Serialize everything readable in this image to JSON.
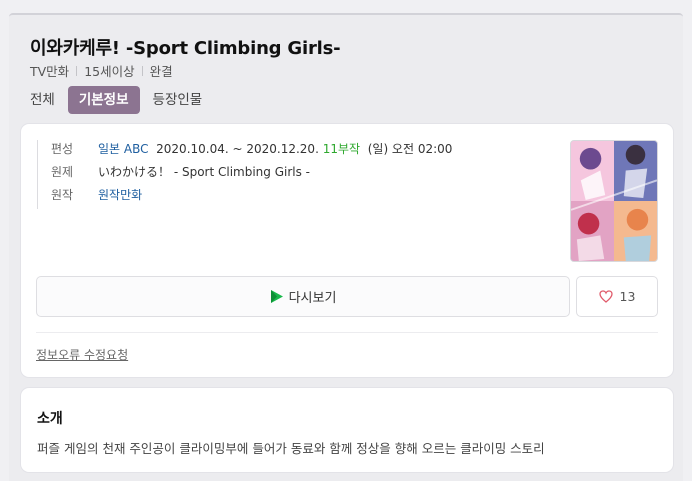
{
  "header": {
    "title": "이와카케루! -Sport Climbing Girls-",
    "meta": [
      "TV만화",
      "15세이상",
      "완결"
    ]
  },
  "tabs": [
    {
      "label": "전체",
      "active": false
    },
    {
      "label": "기본정보",
      "active": true
    },
    {
      "label": "등장인물",
      "active": false
    }
  ],
  "info": {
    "broadcast_label": "편성",
    "broadcast_channel": "일본 ABC",
    "broadcast_period": "2020.10.04. ~ 2020.12.20.",
    "broadcast_episodes": "11부작",
    "broadcast_schedule": "(일) 오전 02:00",
    "original_title_label": "원제",
    "original_title": "いわかける！ - Sport Climbing Girls -",
    "source_label": "원작",
    "source": "원작만화"
  },
  "actions": {
    "replay_label": "다시보기",
    "like_count": "13",
    "report_label": "정보오류 수정요청"
  },
  "intro": {
    "title": "소개",
    "text": "퍼즐 게임의 천재 주인공이 클라이밍부에 들어가 동료와 함께 정상을 향해 오르는 클라이밍 스토리"
  },
  "colors": {
    "active_tab": "#8c7491",
    "link_blue": "#1f5fa0",
    "episodes_green": "#2ea82e",
    "heart": "#e05a6a"
  }
}
